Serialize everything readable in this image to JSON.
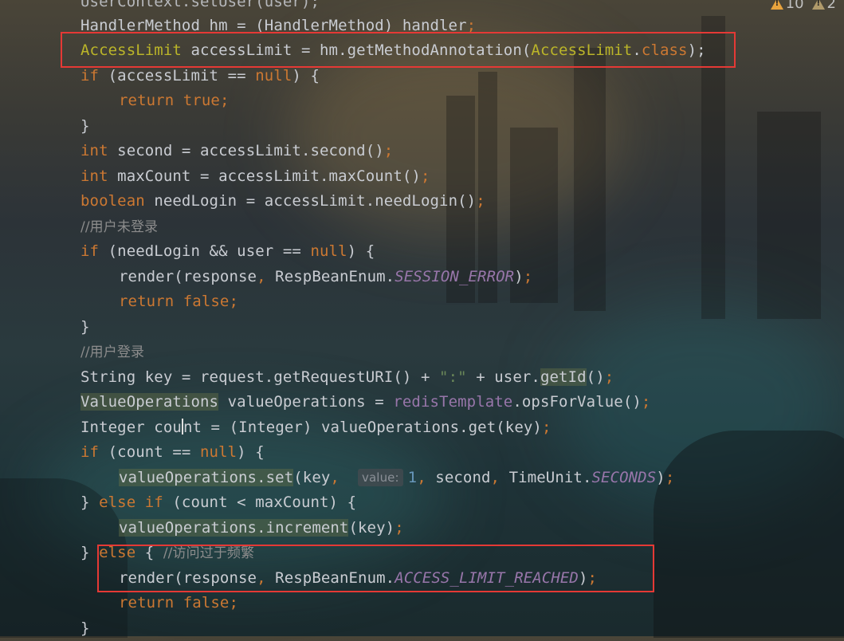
{
  "indicators": {
    "warnings": "10",
    "weak_warnings": "2"
  },
  "code": {
    "l0": "UserContext.setUser(user);",
    "l1_a": "HandlerMethod hm = (HandlerMethod) handler",
    "l1_b": ";",
    "l2_a": "AccessLimit",
    "l2_b": " accessLimit = hm.getMethodAnnotation(",
    "l2_c": "AccessLimit",
    "l2_d": ".",
    "l2_e": "class",
    "l2_f": ");",
    "l3_a": "if",
    "l3_b": " (accessLimit == ",
    "l3_c": "null",
    "l3_d": ") {",
    "l4_a": "return",
    "l4_b": " true",
    "l4_c": ";",
    "l5": "}",
    "l6_a": "int",
    "l6_b": " second = accessLimit.second()",
    "l6_c": ";",
    "l7_a": "int",
    "l7_b": " maxCount = accessLimit.maxCount()",
    "l7_c": ";",
    "l8_a": "boolean",
    "l8_b": " needLogin = accessLimit.needLogin()",
    "l8_c": ";",
    "l9": "//用户未登录",
    "l10_a": "if",
    "l10_b": " (needLogin && user == ",
    "l10_c": "null",
    "l10_d": ") {",
    "l11_a": "render(response",
    "l11_b": ",",
    "l11_c": " RespBeanEnum.",
    "l11_d": "SESSION_ERROR",
    "l11_e": ")",
    "l11_f": ";",
    "l12_a": "return",
    "l12_b": " false",
    "l12_c": ";",
    "l13": "}",
    "l14": "//用户登录",
    "l15_a": "String key = request.getRequestURI() + ",
    "l15_b": "\":\"",
    "l15_c": " + user.",
    "l15_d": "getId",
    "l15_e": "()",
    "l15_f": ";",
    "l16_a": "ValueOperations",
    "l16_b": " valueOperations = ",
    "l16_c": "redisTemplate",
    "l16_d": ".opsForValue()",
    "l16_e": ";",
    "l17_a": "Integer cou",
    "l17_b": "nt = (Integer) valueOperations.get(key)",
    "l17_c": ";",
    "l18_a": "if",
    "l18_b": " (count == ",
    "l18_c": "null",
    "l18_d": ") {",
    "l19_a": "valueOperations.set",
    "l19_b": "(key",
    "l19_c": ",",
    "l19_hint": "value:",
    "l19_d": "1",
    "l19_e": ",",
    "l19_f": " second",
    "l19_g": ",",
    "l19_h": " TimeUnit.",
    "l19_i": "SECONDS",
    "l19_j": ")",
    "l19_k": ";",
    "l20_a": "} ",
    "l20_b": "else if",
    "l20_c": " (count < maxCount) {",
    "l21_a": "valueOperations.increment",
    "l21_b": "(key)",
    "l21_c": ";",
    "l22_a": "} ",
    "l22_b": "else",
    "l22_c": " { ",
    "l22_d": "//访问过于频繁",
    "l23_a": "render(response",
    "l23_b": ",",
    "l23_c": " RespBeanEnum.",
    "l23_d": "ACCESS_LIMIT_REACHED",
    "l23_e": ")",
    "l23_f": ";",
    "l24_a": "return",
    "l24_b": " false",
    "l24_c": ";",
    "l25": "}"
  }
}
